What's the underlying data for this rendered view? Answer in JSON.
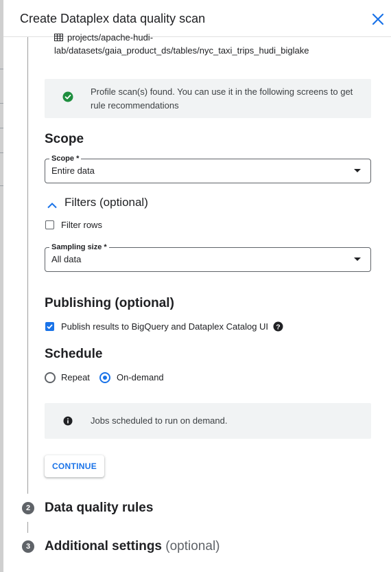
{
  "dialog": {
    "title": "Create Dataplex data quality scan"
  },
  "table_path": {
    "line1": "projects/apache-hudi-",
    "line2": "lab/datasets/gaia_product_ds/tables/nyc_taxi_trips_hudi_biglake"
  },
  "profile_notice": {
    "line1": "Profile scan(s) found. You can use it in the following screens to get",
    "line2": "rule recommendations"
  },
  "scope": {
    "section_title": "Scope",
    "field_label": "Scope *",
    "value": "Entire data"
  },
  "filters": {
    "title": "Filters (optional)",
    "filter_rows_label": "Filter rows",
    "filter_rows_checked": false
  },
  "sampling": {
    "field_label": "Sampling size *",
    "value": "All data"
  },
  "publishing": {
    "section_title": "Publishing (optional)",
    "checkbox_label": "Publish results to BigQuery and Dataplex Catalog UI",
    "checked": true
  },
  "schedule": {
    "section_title": "Schedule",
    "options": [
      {
        "label": "Repeat",
        "selected": false
      },
      {
        "label": "On-demand",
        "selected": true
      }
    ],
    "info": "Jobs scheduled to run on demand."
  },
  "continue_button": "CONTINUE",
  "steps": [
    {
      "number": "2",
      "title": "Data quality rules",
      "suffix": ""
    },
    {
      "number": "3",
      "title": "Additional settings",
      "suffix": "(optional)"
    }
  ],
  "colors": {
    "accent": "#1a73e8",
    "success": "#1e8e3e",
    "info_bg": "#f1f3f4"
  }
}
